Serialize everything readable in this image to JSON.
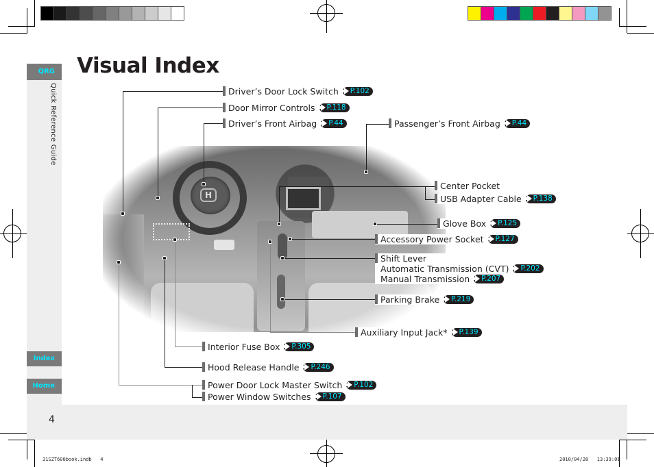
{
  "calibration": {
    "grayscale": [
      "#000000",
      "#1a1a1a",
      "#333333",
      "#4d4d4d",
      "#666666",
      "#808080",
      "#999999",
      "#b3b3b3",
      "#cccccc",
      "#e6e6e6",
      "#ffffff"
    ],
    "colors": [
      "#fff200",
      "#ec008c",
      "#00aeef",
      "#2e3192",
      "#00a651",
      "#ed1c24",
      "#231f20",
      "#fff68f",
      "#f49ac1",
      "#7fd6f7",
      "#939393"
    ]
  },
  "sidebar": {
    "qrg_tab": "QRG",
    "section_title": "Quick Reference Guide",
    "index_tab": "Index",
    "home_tab": "Home"
  },
  "page": {
    "title": "Visual Index",
    "page_number": "4"
  },
  "accent_color": "#00e5ff",
  "callouts": [
    {
      "label": "Driver’s Door Lock Switch",
      "ref": "P.102"
    },
    {
      "label": "Door Mirror Controls",
      "ref": "P.118"
    },
    {
      "label": "Driver’s Front Airbag",
      "ref": "P.44"
    },
    {
      "label": "Passenger’s Front Airbag",
      "ref": "P.44"
    },
    {
      "label": "Center Pocket",
      "ref": null
    },
    {
      "label": "USB Adapter Cable",
      "ref": "P.138"
    },
    {
      "label": "Glove Box",
      "ref": "P.125"
    },
    {
      "label": "Accessory Power Socket",
      "ref": "P.127"
    },
    {
      "label": "Shift Lever",
      "ref": null,
      "sub": [
        {
          "label": "Automatic Transmission (CVT)",
          "ref": "P.202"
        },
        {
          "label": "Manual Transmission",
          "ref": "P.207"
        }
      ]
    },
    {
      "label": "Parking Brake",
      "ref": "P.219"
    },
    {
      "label": "Auxiliary Input Jack*",
      "ref": "P.139"
    },
    {
      "label": "Interior Fuse Box",
      "ref": "P.305"
    },
    {
      "label": "Hood Release Handle",
      "ref": "P.246"
    },
    {
      "label": "Power Door Lock Master Switch",
      "ref": "P.102"
    },
    {
      "label": "Power Window Switches",
      "ref": "P.107"
    }
  ],
  "slug": {
    "file": "31SZT600book.indb   4",
    "timestamp": "2010/04/28   13:39:01"
  }
}
